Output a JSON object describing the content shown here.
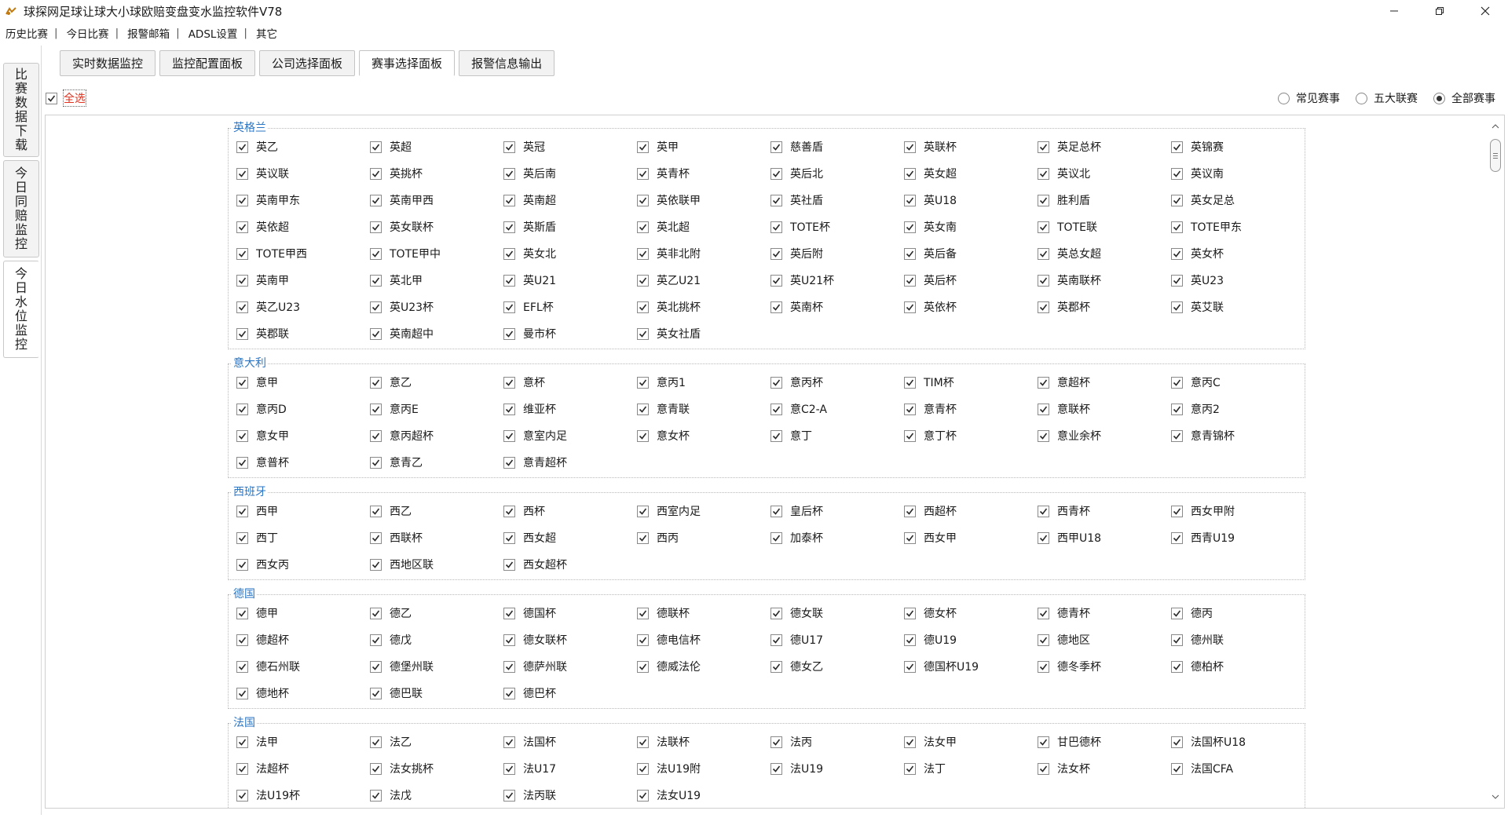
{
  "window": {
    "title": "球探网足球让球大小球欧赔变盘变水监控软件V78"
  },
  "menu": [
    {
      "label": "历史比赛"
    },
    {
      "label": "今日比赛"
    },
    {
      "label": "报警邮箱"
    },
    {
      "label": "ADSL设置"
    },
    {
      "label": "其它"
    }
  ],
  "sidetabs": [
    {
      "label": "比赛数据下载"
    },
    {
      "label": "今日同赔监控"
    },
    {
      "label": "今日水位监控"
    }
  ],
  "tabs": [
    {
      "label": "实时数据监控"
    },
    {
      "label": "监控配置面板"
    },
    {
      "label": "公司选择面板"
    },
    {
      "label": "赛事选择面板"
    },
    {
      "label": "报警信息输出"
    }
  ],
  "select_all": {
    "label": "全选",
    "checked": true
  },
  "filters": [
    {
      "label": "常见赛事",
      "selected": false
    },
    {
      "label": "五大联赛",
      "selected": false
    },
    {
      "label": "全部赛事",
      "selected": true
    }
  ],
  "groups": [
    {
      "title": "英格兰",
      "items": [
        "英乙",
        "英超",
        "英冠",
        "英甲",
        "慈善盾",
        "英联杯",
        "英足总杯",
        "英锦赛",
        "英议联",
        "英挑杯",
        "英后南",
        "英青杯",
        "英后北",
        "英女超",
        "英议北",
        "英议南",
        "英南甲东",
        "英南甲西",
        "英南超",
        "英依联甲",
        "英社盾",
        "英U18",
        "胜利盾",
        "英女足总",
        "英依超",
        "英女联杯",
        "英斯盾",
        "英北超",
        "TOTE杯",
        "英女南",
        "TOTE联",
        "TOTE甲东",
        "TOTE甲西",
        "TOTE甲中",
        "英女北",
        "英非北附",
        "英后附",
        "英后备",
        "英总女超",
        "英女杯",
        "英南甲",
        "英北甲",
        "英U21",
        "英乙U21",
        "英U21杯",
        "英后杯",
        "英南联杯",
        "英U23",
        "英乙U23",
        "英U23杯",
        "EFL杯",
        "英北挑杯",
        "英南杯",
        "英依杯",
        "英郡杯",
        "英艾联",
        "英郡联",
        "英南超中",
        "曼市杯",
        "英女社盾"
      ]
    },
    {
      "title": "意大利",
      "items": [
        "意甲",
        "意乙",
        "意杯",
        "意丙1",
        "意丙杯",
        "TIM杯",
        "意超杯",
        "意丙C",
        "意丙D",
        "意丙E",
        "维亚杯",
        "意青联",
        "意C2-A",
        "意青杯",
        "意联杯",
        "意丙2",
        "意女甲",
        "意丙超杯",
        "意室内足",
        "意女杯",
        "意丁",
        "意丁杯",
        "意业余杯",
        "意青锦杯",
        "意普杯",
        "意青乙",
        "意青超杯"
      ]
    },
    {
      "title": "西班牙",
      "items": [
        "西甲",
        "西乙",
        "西杯",
        "西室内足",
        "皇后杯",
        "西超杯",
        "西青杯",
        "西女甲附",
        "西丁",
        "西联杯",
        "西女超",
        "西丙",
        "加泰杯",
        "西女甲",
        "西甲U18",
        "西青U19",
        "西女丙",
        "西地区联",
        "西女超杯"
      ]
    },
    {
      "title": "德国",
      "items": [
        "德甲",
        "德乙",
        "德国杯",
        "德联杯",
        "德女联",
        "德女杯",
        "德青杯",
        "德丙",
        "德超杯",
        "德戊",
        "德女联杯",
        "德电信杯",
        "德U17",
        "德U19",
        "德地区",
        "德州联",
        "德石州联",
        "德堡州联",
        "德萨州联",
        "德威法伦",
        "德女乙",
        "德国杯U19",
        "德冬季杯",
        "德柏杯",
        "德地杯",
        "德巴联",
        "德巴杯"
      ]
    },
    {
      "title": "法国",
      "items": [
        "法甲",
        "法乙",
        "法国杯",
        "法联杯",
        "法丙",
        "法女甲",
        "甘巴德杯",
        "法国杯U18",
        "法超杯",
        "法女挑杯",
        "法U17",
        "法U19附",
        "法U19",
        "法丁",
        "法女杯",
        "法国CFA",
        "法U19杯",
        "法戊",
        "法丙联",
        "法女U19"
      ]
    }
  ]
}
